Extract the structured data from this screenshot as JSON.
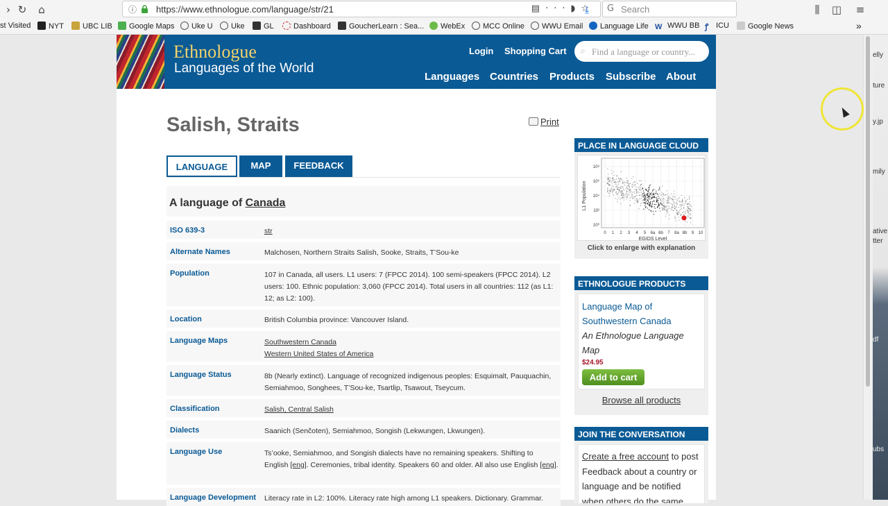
{
  "browser": {
    "url": "https://www.ethnologue.com/language/str/21",
    "search_placeholder": "Search",
    "bookmarks": [
      "st Visited",
      "NYT",
      "UBC LIB",
      "Google Maps",
      "Uke U",
      "Uke",
      "GL",
      "Dashboard",
      "GoucherLearn : Sea...",
      "WebEx",
      "MCC Online",
      "WWU Email",
      "Language Life",
      "WWU BB",
      "ICU",
      "Google News"
    ],
    "overflow_glyph": "»"
  },
  "header": {
    "logo_title": "Ethnologue",
    "logo_subtitle": "Languages of the World",
    "login": "Login",
    "cart": "Shopping Cart",
    "search_placeholder": "Find a language or country...",
    "nav": [
      "Languages",
      "Countries",
      "Products",
      "Subscribe",
      "About"
    ]
  },
  "main": {
    "title": "Salish, Straits",
    "print": "Print",
    "tabs": [
      "LANGUAGE",
      "MAP",
      "FEEDBACK"
    ],
    "language_of_prefix": "A language of ",
    "language_of_country": "Canada",
    "rows": [
      {
        "key": "ISO 639-3",
        "value": "str"
      },
      {
        "key": "Alternate Names",
        "value": "Malchosen, Northern Straits Salish, Sooke, Straits, T’Sou-ke"
      },
      {
        "key": "Population",
        "value": "107 in Canada, all users. L1 users: 7 (FPCC 2014). 100 semi-speakers (FPCC 2014). L2 users: 100. Ethnic population: 3,060 (FPCC 2014). Total users in all countries: 112 (as L1: 12; as L2: 100)."
      },
      {
        "key": "Location",
        "value": "British Columbia province: Vancouver Island."
      },
      {
        "key": "Language Maps",
        "value": "Southwestern Canada",
        "value2": "Western United States of America"
      },
      {
        "key": "Language Status",
        "value": "8b (Nearly extinct). Language of recognized indigenous peoples: Esquimalt, Pauquachin, Semiahmoo, Songhees, T’Sou-ke, Tsartlip, Tsawout, Tseycum."
      },
      {
        "key": "Classification",
        "value": "Salish, Central Salish"
      },
      {
        "key": "Dialects",
        "value": "Saanich (Senčoten), Semiahmoo, Songish (Lekwungen, Lkwungen)."
      },
      {
        "key": "Language Use",
        "value_a": "Ts’ooke, Semiahmoo, and Songish dialects have no remaining speakers. Shifting to English ",
        "value_link1": "[eng]",
        "value_b": ". Ceremonies, tribal identity. Speakers 60 and older. All also use English ",
        "value_link2": "[eng]",
        "value_c": "."
      },
      {
        "key": "Language Development",
        "value": "Literacy rate in L2: 100%. Literacy rate high among L1 speakers. Dictionary. Grammar."
      }
    ]
  },
  "sidebar": {
    "cloud_heading": "PLACE IN LANGUAGE CLOUD",
    "cloud_caption": "Click to enlarge with explanation",
    "cloud_ylabel": "L1 Population",
    "cloud_xlabel": "EGIDS Level",
    "cloud_xticks": [
      "0",
      "1",
      "2",
      "3",
      "4",
      "5",
      "6a",
      "6b",
      "7",
      "8a",
      "8b",
      "9",
      "10"
    ],
    "cloud_yticks": [
      "10⁸",
      "10⁶",
      "10⁴",
      "10²",
      "10⁰"
    ],
    "products_heading": "ETHNOLOGUE PRODUCTS",
    "product_name": "Language Map of Southwestern Canada",
    "product_sub": "An Ethnologue Language Map",
    "product_price": "$24.95",
    "add_to_cart": "Add to cart",
    "browse_all": "Browse all products",
    "conversation_heading": "JOIN THE CONVERSATION",
    "conversation_link": "Create a free account",
    "conversation_text": " to post Feedback about a country or language and be notified when others do the same."
  },
  "desktop_labels": [
    "elly",
    "ture",
    "y.jp",
    "mily",
    "ative",
    "tter",
    "df",
    "ubs"
  ],
  "colors": {
    "brand_blue": "#0a5a95",
    "logo_gold": "#f3d36a",
    "cart_green": "#5ea12a",
    "price_red": "#a3162a"
  }
}
